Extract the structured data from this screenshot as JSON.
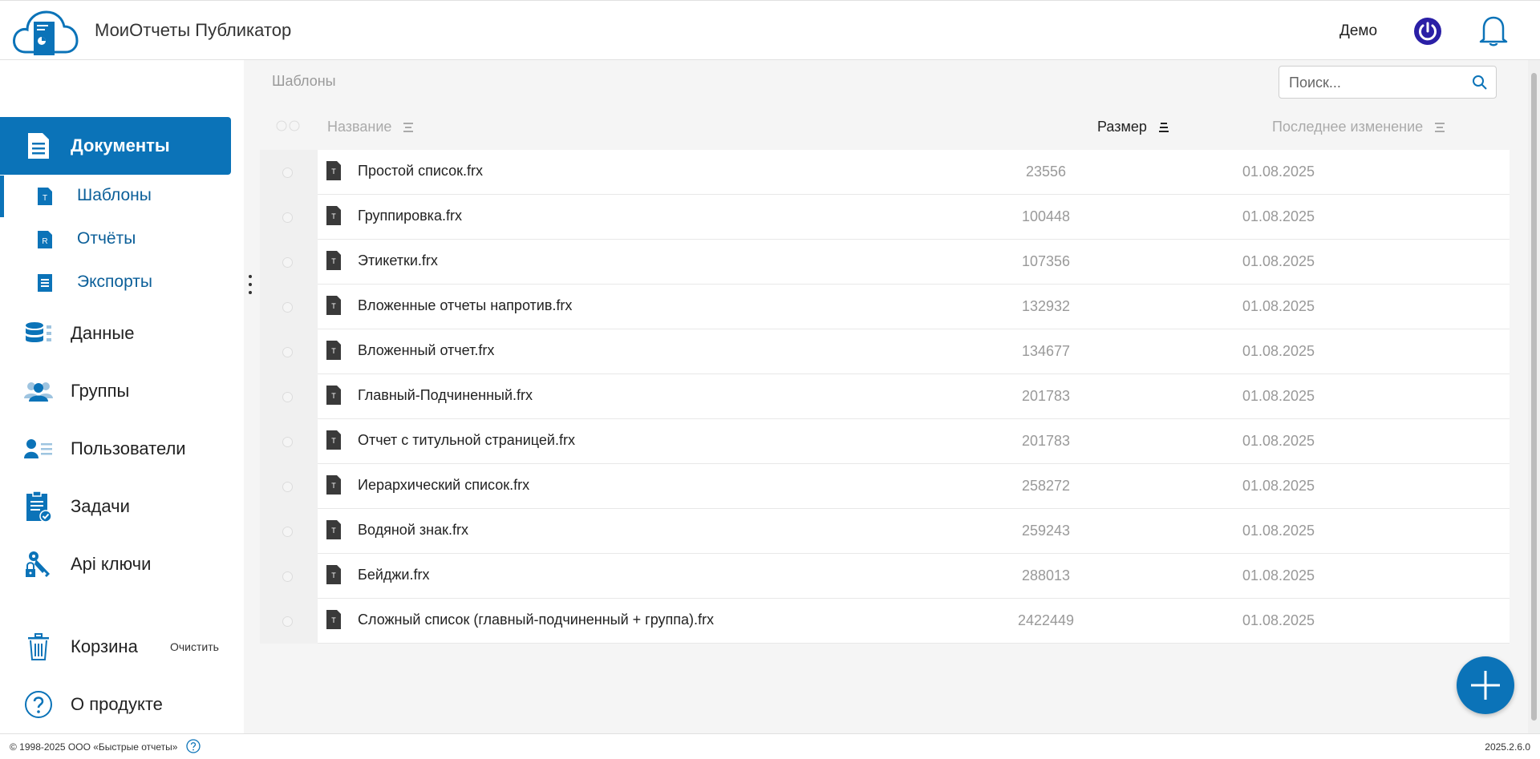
{
  "header": {
    "title": "МоиОтчеты Публикатор",
    "user": "Демо",
    "power_icon": "power-icon",
    "bell_icon": "bell-icon"
  },
  "sidebar": {
    "main_items": [
      {
        "label": "Документы",
        "icon": "documents-icon"
      },
      {
        "label": "Данные",
        "icon": "database-icon"
      },
      {
        "label": "Группы",
        "icon": "groups-icon"
      },
      {
        "label": "Пользователи",
        "icon": "users-icon"
      },
      {
        "label": "Задачи",
        "icon": "tasks-icon"
      },
      {
        "label": "Api ключи",
        "icon": "api-key-icon"
      },
      {
        "label": "Корзина",
        "icon": "trash-icon"
      },
      {
        "label": "О продукте",
        "icon": "question-icon"
      }
    ],
    "sub_items": [
      {
        "label": "Шаблоны",
        "icon": "template-file-icon",
        "letter": "T"
      },
      {
        "label": "Отчёты",
        "icon": "report-file-icon",
        "letter": "R"
      },
      {
        "label": "Экспорты",
        "icon": "export-file-icon",
        "letter": ""
      }
    ],
    "clear_label": "Очистить"
  },
  "main": {
    "breadcrumb": "Шаблоны",
    "search_placeholder": "Поиск...",
    "columns": {
      "name": "Название",
      "size": "Размер",
      "modified": "Последнее изменение"
    },
    "rows": [
      {
        "name": "Простой список.frx",
        "size": "23556",
        "date": "01.08.2025"
      },
      {
        "name": "Группировка.frx",
        "size": "100448",
        "date": "01.08.2025"
      },
      {
        "name": "Этикетки.frx",
        "size": "107356",
        "date": "01.08.2025"
      },
      {
        "name": "Вложенные отчеты напротив.frx",
        "size": "132932",
        "date": "01.08.2025"
      },
      {
        "name": "Вложенный отчет.frx",
        "size": "134677",
        "date": "01.08.2025"
      },
      {
        "name": "Главный-Подчиненный.frx",
        "size": "201783",
        "date": "01.08.2025"
      },
      {
        "name": "Отчет с титульной страницей.frx",
        "size": "201783",
        "date": "01.08.2025"
      },
      {
        "name": "Иерархический список.frx",
        "size": "258272",
        "date": "01.08.2025"
      },
      {
        "name": "Водяной знак.frx",
        "size": "259243",
        "date": "01.08.2025"
      },
      {
        "name": "Бейджи.frx",
        "size": "288013",
        "date": "01.08.2025"
      },
      {
        "name": "Сложный список (главный-подчиненный + группа).frx",
        "size": "2422449",
        "date": "01.08.2025"
      }
    ],
    "file_icon_letter": "T"
  },
  "footer": {
    "copyright": "© 1998-2025 ООО «Быстрые отчеты»",
    "version": "2025.2.6.0"
  },
  "colors": {
    "accent": "#0b73b8",
    "power": "#2a1fa6"
  }
}
